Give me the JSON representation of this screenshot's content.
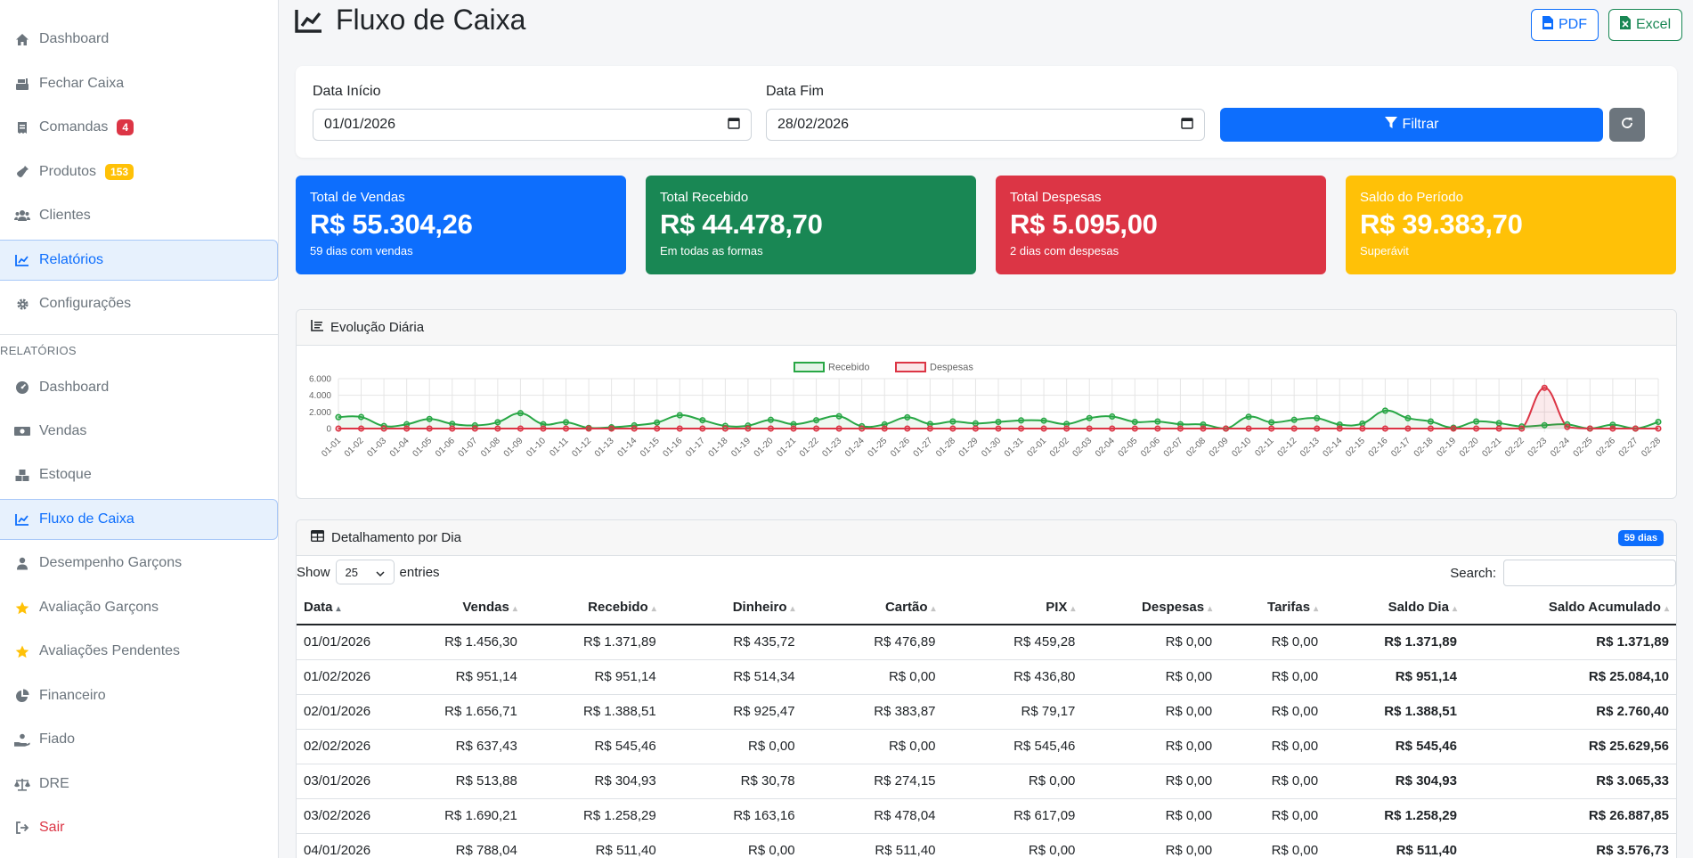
{
  "sidebar": {
    "items": [
      {
        "label": "Dashboard",
        "icon": "home-icon"
      },
      {
        "label": "Fechar Caixa",
        "icon": "cash-register-icon"
      },
      {
        "label": "Comandas",
        "icon": "receipt-icon",
        "badge": "4"
      },
      {
        "label": "Produtos",
        "icon": "wine-bottle-icon",
        "badge": "153"
      },
      {
        "label": "Clientes",
        "icon": "users-icon"
      },
      {
        "label": "Relatórios",
        "icon": "line-chart-icon",
        "active": true
      },
      {
        "label": "Configurações",
        "icon": "gear-icon"
      }
    ],
    "section_label": "RELATÓRIOS",
    "report_items": [
      {
        "label": "Dashboard",
        "icon": "tachometer-icon"
      },
      {
        "label": "Vendas",
        "icon": "money-icon"
      },
      {
        "label": "Estoque",
        "icon": "boxes-icon"
      },
      {
        "label": "Fluxo de Caixa",
        "icon": "line-chart-icon",
        "active": true
      },
      {
        "label": "Desempenho Garçons",
        "icon": "user-tie-icon"
      },
      {
        "label": "Avaliação Garçons",
        "icon": "star-icon"
      },
      {
        "label": "Avaliações Pendentes",
        "icon": "star-icon"
      },
      {
        "label": "Financeiro",
        "icon": "pie-chart-icon"
      },
      {
        "label": "Fiado",
        "icon": "hand-holding-icon"
      },
      {
        "label": "DRE",
        "icon": "balance-scale-icon"
      },
      {
        "label": "Sair",
        "icon": "sign-out-icon"
      }
    ]
  },
  "header": {
    "title": "Fluxo de Caixa",
    "pdf_label": "PDF",
    "excel_label": "Excel"
  },
  "filters": {
    "start_label": "Data Início",
    "start_value": "01/01/2026",
    "end_label": "Data Fim",
    "end_value": "28/02/2026",
    "filter_button": "Filtrar"
  },
  "stats": [
    {
      "label": "Total de Vendas",
      "value": "R$ 55.304,26",
      "sub": "59 dias com vendas",
      "color": "#0d6efd"
    },
    {
      "label": "Total Recebido",
      "value": "R$ 44.478,70",
      "sub": "Em todas as formas",
      "color": "#198754"
    },
    {
      "label": "Total Despesas",
      "value": "R$ 5.095,00",
      "sub": "2 dias com despesas",
      "color": "#dc3545"
    },
    {
      "label": "Saldo do Período",
      "value": "R$ 39.383,70",
      "sub": "Superávit",
      "color": "#ffc107"
    }
  ],
  "chart_title": "Evolução Diária",
  "chart_data": {
    "type": "line",
    "title": "",
    "xlabel": "",
    "ylabel": "",
    "ylim": [
      0,
      6000
    ],
    "yticks": [
      "0",
      "2.000",
      "4.000",
      "6.000"
    ],
    "grid": true,
    "legend": "top-center",
    "categories": [
      "01-01",
      "01-02",
      "01-03",
      "01-04",
      "01-05",
      "01-06",
      "01-07",
      "01-08",
      "01-09",
      "01-10",
      "01-11",
      "01-12",
      "01-13",
      "01-14",
      "01-15",
      "01-16",
      "01-17",
      "01-18",
      "01-19",
      "01-20",
      "01-21",
      "01-22",
      "01-23",
      "01-24",
      "01-25",
      "01-26",
      "01-27",
      "01-28",
      "01-29",
      "01-30",
      "01-31",
      "02-01",
      "02-02",
      "02-03",
      "02-04",
      "02-05",
      "02-06",
      "02-07",
      "02-08",
      "02-09",
      "02-10",
      "02-11",
      "02-12",
      "02-13",
      "02-14",
      "02-15",
      "02-16",
      "02-17",
      "02-18",
      "02-19",
      "02-20",
      "02-21",
      "02-22",
      "02-23",
      "02-24",
      "02-25",
      "02-26",
      "02-27",
      "02-28"
    ],
    "series": [
      {
        "name": "Recebido",
        "color": "#28a745",
        "values": [
          1372,
          1388,
          305,
          511,
          1150,
          560,
          380,
          760,
          1850,
          520,
          760,
          80,
          150,
          380,
          720,
          1600,
          1000,
          320,
          350,
          1050,
          520,
          1000,
          1480,
          280,
          500,
          1350,
          550,
          850,
          620,
          800,
          980,
          951,
          545,
          1258,
          1450,
          800,
          850,
          520,
          480,
          0,
          1420,
          750,
          1050,
          1250,
          480,
          600,
          2150,
          1250,
          850,
          100,
          850,
          650,
          250,
          400,
          500,
          0,
          450,
          0,
          800
        ]
      },
      {
        "name": "Despesas",
        "color": "#dc3545",
        "values": [
          0,
          0,
          0,
          0,
          0,
          0,
          0,
          0,
          0,
          0,
          0,
          0,
          0,
          0,
          0,
          0,
          0,
          0,
          0,
          0,
          0,
          0,
          0,
          0,
          0,
          0,
          0,
          0,
          0,
          0,
          0,
          0,
          0,
          0,
          0,
          0,
          0,
          0,
          0,
          0,
          0,
          0,
          0,
          0,
          0,
          0,
          0,
          0,
          0,
          0,
          0,
          0,
          0,
          4900,
          195,
          0,
          0,
          0,
          0
        ]
      }
    ]
  },
  "table": {
    "title": "Detalhamento por Dia",
    "count_badge": "59 dias",
    "show_label": "Show",
    "show_value": "25",
    "entries_label": "entries",
    "search_label": "Search:",
    "columns": [
      "Data",
      "Vendas",
      "Recebido",
      "Dinheiro",
      "Cartão",
      "PIX",
      "Despesas",
      "Tarifas",
      "Saldo Dia",
      "Saldo Acumulado"
    ],
    "rows": [
      [
        "01/01/2026",
        "R$ 1.456,30",
        "R$ 1.371,89",
        "R$ 435,72",
        "R$ 476,89",
        "R$ 459,28",
        "R$ 0,00",
        "R$ 0,00",
        "R$ 1.371,89",
        "R$ 1.371,89"
      ],
      [
        "01/02/2026",
        "R$ 951,14",
        "R$ 951,14",
        "R$ 514,34",
        "R$ 0,00",
        "R$ 436,80",
        "R$ 0,00",
        "R$ 0,00",
        "R$ 951,14",
        "R$ 25.084,10"
      ],
      [
        "02/01/2026",
        "R$ 1.656,71",
        "R$ 1.388,51",
        "R$ 925,47",
        "R$ 383,87",
        "R$ 79,17",
        "R$ 0,00",
        "R$ 0,00",
        "R$ 1.388,51",
        "R$ 2.760,40"
      ],
      [
        "02/02/2026",
        "R$ 637,43",
        "R$ 545,46",
        "R$ 0,00",
        "R$ 0,00",
        "R$ 545,46",
        "R$ 0,00",
        "R$ 0,00",
        "R$ 545,46",
        "R$ 25.629,56"
      ],
      [
        "03/01/2026",
        "R$ 513,88",
        "R$ 304,93",
        "R$ 30,78",
        "R$ 274,15",
        "R$ 0,00",
        "R$ 0,00",
        "R$ 0,00",
        "R$ 304,93",
        "R$ 3.065,33"
      ],
      [
        "03/02/2026",
        "R$ 1.690,21",
        "R$ 1.258,29",
        "R$ 163,16",
        "R$ 478,04",
        "R$ 617,09",
        "R$ 0,00",
        "R$ 0,00",
        "R$ 1.258,29",
        "R$ 26.887,85"
      ],
      [
        "04/01/2026",
        "R$ 788,04",
        "R$ 511,40",
        "R$ 0,00",
        "R$ 511,40",
        "R$ 0,00",
        "R$ 0,00",
        "R$ 0,00",
        "R$ 511,40",
        "R$ 3.576,73"
      ]
    ]
  }
}
